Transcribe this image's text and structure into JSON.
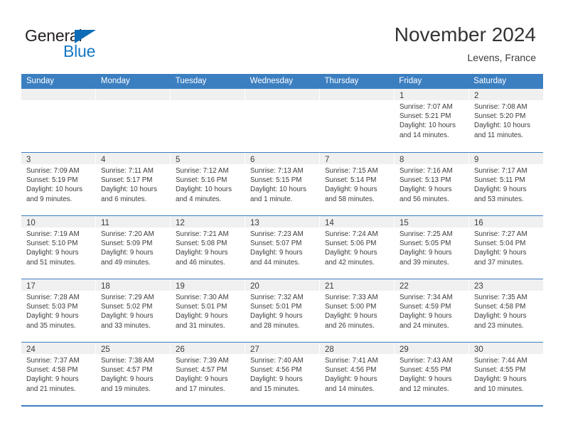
{
  "brand": {
    "name_part1": "General",
    "name_part2": "Blue",
    "triangle_color": "#0d6cb5",
    "blue_text_color": "#1577c4"
  },
  "header": {
    "title": "November 2024",
    "subtitle": "Levens, France"
  },
  "theme": {
    "header_row_color": "#3c7fc1",
    "day_band_color": "#f0f0f0",
    "text_color": "#3c3c3c"
  },
  "calendar": {
    "weekday_headers": [
      "Sunday",
      "Monday",
      "Tuesday",
      "Wednesday",
      "Thursday",
      "Friday",
      "Saturday"
    ],
    "weeks": [
      [
        {
          "day": "",
          "empty": true
        },
        {
          "day": "",
          "empty": true
        },
        {
          "day": "",
          "empty": true
        },
        {
          "day": "",
          "empty": true
        },
        {
          "day": "",
          "empty": true
        },
        {
          "day": "1",
          "sunrise": "Sunrise: 7:07 AM",
          "sunset": "Sunset: 5:21 PM",
          "daylight_line1": "Daylight: 10 hours",
          "daylight_line2": "and 14 minutes."
        },
        {
          "day": "2",
          "sunrise": "Sunrise: 7:08 AM",
          "sunset": "Sunset: 5:20 PM",
          "daylight_line1": "Daylight: 10 hours",
          "daylight_line2": "and 11 minutes."
        }
      ],
      [
        {
          "day": "3",
          "sunrise": "Sunrise: 7:09 AM",
          "sunset": "Sunset: 5:19 PM",
          "daylight_line1": "Daylight: 10 hours",
          "daylight_line2": "and 9 minutes."
        },
        {
          "day": "4",
          "sunrise": "Sunrise: 7:11 AM",
          "sunset": "Sunset: 5:17 PM",
          "daylight_line1": "Daylight: 10 hours",
          "daylight_line2": "and 6 minutes."
        },
        {
          "day": "5",
          "sunrise": "Sunrise: 7:12 AM",
          "sunset": "Sunset: 5:16 PM",
          "daylight_line1": "Daylight: 10 hours",
          "daylight_line2": "and 4 minutes."
        },
        {
          "day": "6",
          "sunrise": "Sunrise: 7:13 AM",
          "sunset": "Sunset: 5:15 PM",
          "daylight_line1": "Daylight: 10 hours",
          "daylight_line2": "and 1 minute."
        },
        {
          "day": "7",
          "sunrise": "Sunrise: 7:15 AM",
          "sunset": "Sunset: 5:14 PM",
          "daylight_line1": "Daylight: 9 hours",
          "daylight_line2": "and 58 minutes."
        },
        {
          "day": "8",
          "sunrise": "Sunrise: 7:16 AM",
          "sunset": "Sunset: 5:13 PM",
          "daylight_line1": "Daylight: 9 hours",
          "daylight_line2": "and 56 minutes."
        },
        {
          "day": "9",
          "sunrise": "Sunrise: 7:17 AM",
          "sunset": "Sunset: 5:11 PM",
          "daylight_line1": "Daylight: 9 hours",
          "daylight_line2": "and 53 minutes."
        }
      ],
      [
        {
          "day": "10",
          "sunrise": "Sunrise: 7:19 AM",
          "sunset": "Sunset: 5:10 PM",
          "daylight_line1": "Daylight: 9 hours",
          "daylight_line2": "and 51 minutes."
        },
        {
          "day": "11",
          "sunrise": "Sunrise: 7:20 AM",
          "sunset": "Sunset: 5:09 PM",
          "daylight_line1": "Daylight: 9 hours",
          "daylight_line2": "and 49 minutes."
        },
        {
          "day": "12",
          "sunrise": "Sunrise: 7:21 AM",
          "sunset": "Sunset: 5:08 PM",
          "daylight_line1": "Daylight: 9 hours",
          "daylight_line2": "and 46 minutes."
        },
        {
          "day": "13",
          "sunrise": "Sunrise: 7:23 AM",
          "sunset": "Sunset: 5:07 PM",
          "daylight_line1": "Daylight: 9 hours",
          "daylight_line2": "and 44 minutes."
        },
        {
          "day": "14",
          "sunrise": "Sunrise: 7:24 AM",
          "sunset": "Sunset: 5:06 PM",
          "daylight_line1": "Daylight: 9 hours",
          "daylight_line2": "and 42 minutes."
        },
        {
          "day": "15",
          "sunrise": "Sunrise: 7:25 AM",
          "sunset": "Sunset: 5:05 PM",
          "daylight_line1": "Daylight: 9 hours",
          "daylight_line2": "and 39 minutes."
        },
        {
          "day": "16",
          "sunrise": "Sunrise: 7:27 AM",
          "sunset": "Sunset: 5:04 PM",
          "daylight_line1": "Daylight: 9 hours",
          "daylight_line2": "and 37 minutes."
        }
      ],
      [
        {
          "day": "17",
          "sunrise": "Sunrise: 7:28 AM",
          "sunset": "Sunset: 5:03 PM",
          "daylight_line1": "Daylight: 9 hours",
          "daylight_line2": "and 35 minutes."
        },
        {
          "day": "18",
          "sunrise": "Sunrise: 7:29 AM",
          "sunset": "Sunset: 5:02 PM",
          "daylight_line1": "Daylight: 9 hours",
          "daylight_line2": "and 33 minutes."
        },
        {
          "day": "19",
          "sunrise": "Sunrise: 7:30 AM",
          "sunset": "Sunset: 5:01 PM",
          "daylight_line1": "Daylight: 9 hours",
          "daylight_line2": "and 31 minutes."
        },
        {
          "day": "20",
          "sunrise": "Sunrise: 7:32 AM",
          "sunset": "Sunset: 5:01 PM",
          "daylight_line1": "Daylight: 9 hours",
          "daylight_line2": "and 28 minutes."
        },
        {
          "day": "21",
          "sunrise": "Sunrise: 7:33 AM",
          "sunset": "Sunset: 5:00 PM",
          "daylight_line1": "Daylight: 9 hours",
          "daylight_line2": "and 26 minutes."
        },
        {
          "day": "22",
          "sunrise": "Sunrise: 7:34 AM",
          "sunset": "Sunset: 4:59 PM",
          "daylight_line1": "Daylight: 9 hours",
          "daylight_line2": "and 24 minutes."
        },
        {
          "day": "23",
          "sunrise": "Sunrise: 7:35 AM",
          "sunset": "Sunset: 4:58 PM",
          "daylight_line1": "Daylight: 9 hours",
          "daylight_line2": "and 23 minutes."
        }
      ],
      [
        {
          "day": "24",
          "sunrise": "Sunrise: 7:37 AM",
          "sunset": "Sunset: 4:58 PM",
          "daylight_line1": "Daylight: 9 hours",
          "daylight_line2": "and 21 minutes."
        },
        {
          "day": "25",
          "sunrise": "Sunrise: 7:38 AM",
          "sunset": "Sunset: 4:57 PM",
          "daylight_line1": "Daylight: 9 hours",
          "daylight_line2": "and 19 minutes."
        },
        {
          "day": "26",
          "sunrise": "Sunrise: 7:39 AM",
          "sunset": "Sunset: 4:57 PM",
          "daylight_line1": "Daylight: 9 hours",
          "daylight_line2": "and 17 minutes."
        },
        {
          "day": "27",
          "sunrise": "Sunrise: 7:40 AM",
          "sunset": "Sunset: 4:56 PM",
          "daylight_line1": "Daylight: 9 hours",
          "daylight_line2": "and 15 minutes."
        },
        {
          "day": "28",
          "sunrise": "Sunrise: 7:41 AM",
          "sunset": "Sunset: 4:56 PM",
          "daylight_line1": "Daylight: 9 hours",
          "daylight_line2": "and 14 minutes."
        },
        {
          "day": "29",
          "sunrise": "Sunrise: 7:43 AM",
          "sunset": "Sunset: 4:55 PM",
          "daylight_line1": "Daylight: 9 hours",
          "daylight_line2": "and 12 minutes."
        },
        {
          "day": "30",
          "sunrise": "Sunrise: 7:44 AM",
          "sunset": "Sunset: 4:55 PM",
          "daylight_line1": "Daylight: 9 hours",
          "daylight_line2": "and 10 minutes."
        }
      ]
    ]
  }
}
